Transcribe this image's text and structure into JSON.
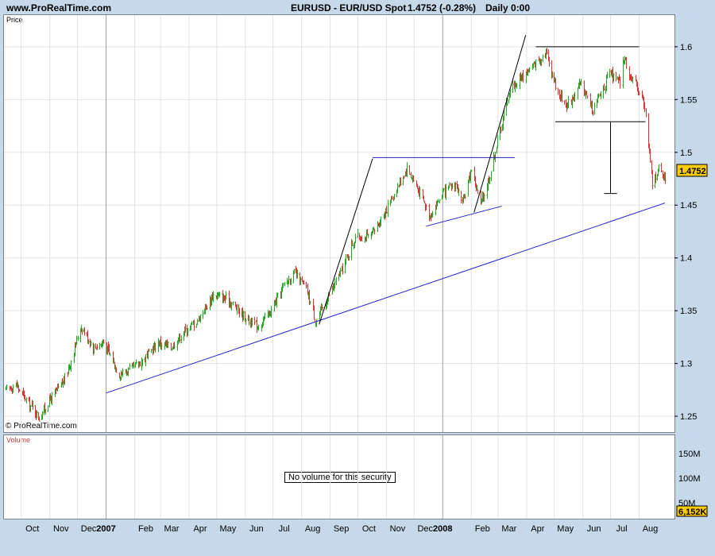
{
  "header": {
    "site": "www.ProRealTime.com",
    "symbol": "EURUSD - EUR/USD Spot",
    "quote": "1.4752 (-0.28%)",
    "timeframe": "Daily  0:00"
  },
  "price_panel": {
    "label": "Price",
    "copyright": "© ProRealTime.com"
  },
  "volume_panel": {
    "label": "Volume",
    "message": "No volume for this security",
    "ticks": [
      "150M",
      "100M",
      "50M"
    ],
    "last_value": "6,152K"
  },
  "colors": {
    "up_candle": "#22aa22",
    "down_candle": "#dd3333",
    "trendline_blue": "#2222cc",
    "trendline_black": "#000000",
    "last_price_badge": "#ffcc00",
    "background": "#c5d9ea"
  },
  "chart_data": {
    "type": "candlestick",
    "title": "EURUSD - EUR/USD Spot",
    "last_price": "1.4752",
    "change": "-0.28%",
    "interval": "Daily",
    "ylim": [
      1.235,
      1.63
    ],
    "y_ticks": [
      "1.6",
      "1.55",
      "1.5",
      "1.45",
      "1.4",
      "1.35",
      "1.3",
      "1.25"
    ],
    "x_range": [
      "2006-09-14",
      "2008-08-29"
    ],
    "x_ticks": [
      {
        "label": "Oct",
        "date": "2006-10-01"
      },
      {
        "label": "Nov",
        "date": "2006-11-01"
      },
      {
        "label": "Dec",
        "date": "2006-12-01"
      },
      {
        "label": "2007",
        "date": "2007-01-01",
        "bold": true
      },
      {
        "label": "Feb",
        "date": "2007-02-01"
      },
      {
        "label": "Mar",
        "date": "2007-03-01"
      },
      {
        "label": "Apr",
        "date": "2007-04-01"
      },
      {
        "label": "May",
        "date": "2007-05-01"
      },
      {
        "label": "Jun",
        "date": "2007-06-01"
      },
      {
        "label": "Jul",
        "date": "2007-07-01"
      },
      {
        "label": "Aug",
        "date": "2007-08-01"
      },
      {
        "label": "Sep",
        "date": "2007-09-01"
      },
      {
        "label": "Oct",
        "date": "2007-10-01"
      },
      {
        "label": "Nov",
        "date": "2007-11-01"
      },
      {
        "label": "Dec",
        "date": "2007-12-01"
      },
      {
        "label": "2008",
        "date": "2008-01-01",
        "bold": true
      },
      {
        "label": "Feb",
        "date": "2008-02-01"
      },
      {
        "label": "Mar",
        "date": "2008-03-01"
      },
      {
        "label": "Apr",
        "date": "2008-04-01"
      },
      {
        "label": "May",
        "date": "2008-05-01"
      },
      {
        "label": "Jun",
        "date": "2008-06-01"
      },
      {
        "label": "Jul",
        "date": "2008-07-01"
      },
      {
        "label": "Aug",
        "date": "2008-08-01"
      }
    ],
    "close_path": [
      [
        "2006-09-14",
        1.275
      ],
      [
        "2006-09-25",
        1.28
      ],
      [
        "2006-10-09",
        1.262
      ],
      [
        "2006-10-16",
        1.255
      ],
      [
        "2006-10-20",
        1.248
      ],
      [
        "2006-10-31",
        1.265
      ],
      [
        "2006-11-15",
        1.282
      ],
      [
        "2006-11-23",
        1.3
      ],
      [
        "2006-12-01",
        1.325
      ],
      [
        "2006-12-05",
        1.335
      ],
      [
        "2006-12-18",
        1.315
      ],
      [
        "2006-12-29",
        1.32
      ],
      [
        "2007-01-15",
        1.29
      ],
      [
        "2007-01-29",
        1.295
      ],
      [
        "2007-02-12",
        1.305
      ],
      [
        "2007-02-26",
        1.32
      ],
      [
        "2007-03-12",
        1.315
      ],
      [
        "2007-03-26",
        1.33
      ],
      [
        "2007-04-09",
        1.34
      ],
      [
        "2007-04-27",
        1.365
      ],
      [
        "2007-05-14",
        1.36
      ],
      [
        "2007-05-30",
        1.345
      ],
      [
        "2007-06-14",
        1.335
      ],
      [
        "2007-06-29",
        1.35
      ],
      [
        "2007-07-13",
        1.375
      ],
      [
        "2007-07-24",
        1.385
      ],
      [
        "2007-08-06",
        1.37
      ],
      [
        "2007-08-16",
        1.34
      ],
      [
        "2007-08-31",
        1.365
      ],
      [
        "2007-09-14",
        1.39
      ],
      [
        "2007-09-28",
        1.42
      ],
      [
        "2007-10-15",
        1.42
      ],
      [
        "2007-10-31",
        1.445
      ],
      [
        "2007-11-23",
        1.485
      ],
      [
        "2007-12-05",
        1.465
      ],
      [
        "2007-12-18",
        1.44
      ],
      [
        "2007-12-31",
        1.46
      ],
      [
        "2008-01-15",
        1.47
      ],
      [
        "2008-01-22",
        1.45
      ],
      [
        "2008-02-01",
        1.485
      ],
      [
        "2008-02-11",
        1.45
      ],
      [
        "2008-02-20",
        1.475
      ],
      [
        "2008-02-29",
        1.51
      ],
      [
        "2008-03-14",
        1.56
      ],
      [
        "2008-03-31",
        1.575
      ],
      [
        "2008-04-22",
        1.595
      ],
      [
        "2008-05-05",
        1.555
      ],
      [
        "2008-05-15",
        1.545
      ],
      [
        "2008-05-30",
        1.565
      ],
      [
        "2008-06-12",
        1.54
      ],
      [
        "2008-06-30",
        1.575
      ],
      [
        "2008-07-11",
        1.565
      ],
      [
        "2008-07-15",
        1.59
      ],
      [
        "2008-07-23",
        1.57
      ],
      [
        "2008-08-04",
        1.555
      ],
      [
        "2008-08-08",
        1.535
      ],
      [
        "2008-08-15",
        1.47
      ],
      [
        "2008-08-22",
        1.485
      ],
      [
        "2008-08-29",
        1.4752
      ]
    ],
    "trendlines": [
      {
        "color": "blue",
        "points": [
          [
            "2007-01-01",
            1.272
          ],
          [
            "2008-08-29",
            1.452
          ]
        ]
      },
      {
        "color": "blue",
        "points": [
          [
            "2007-10-17",
            1.495
          ],
          [
            "2008-03-19",
            1.495
          ]
        ]
      },
      {
        "color": "blue",
        "points": [
          [
            "2007-12-14",
            1.43
          ],
          [
            "2008-03-05",
            1.449
          ]
        ]
      },
      {
        "color": "black",
        "points": [
          [
            "2007-08-20",
            1.337
          ],
          [
            "2007-10-17",
            1.494
          ]
        ]
      },
      {
        "color": "black",
        "points": [
          [
            "2008-02-04",
            1.443
          ],
          [
            "2008-03-31",
            1.611
          ]
        ]
      },
      {
        "color": "black",
        "points": [
          [
            "2008-04-11",
            1.6
          ],
          [
            "2008-08-01",
            1.6
          ]
        ]
      },
      {
        "color": "black",
        "points": [
          [
            "2008-05-02",
            1.529
          ],
          [
            "2008-08-08",
            1.529
          ]
        ]
      },
      {
        "color": "black",
        "points": [
          [
            "2008-07-01",
            1.529
          ],
          [
            "2008-07-01",
            1.461
          ]
        ]
      },
      {
        "color": "black",
        "points": [
          [
            "2008-06-24",
            1.461
          ],
          [
            "2008-07-08",
            1.461
          ]
        ]
      }
    ]
  }
}
